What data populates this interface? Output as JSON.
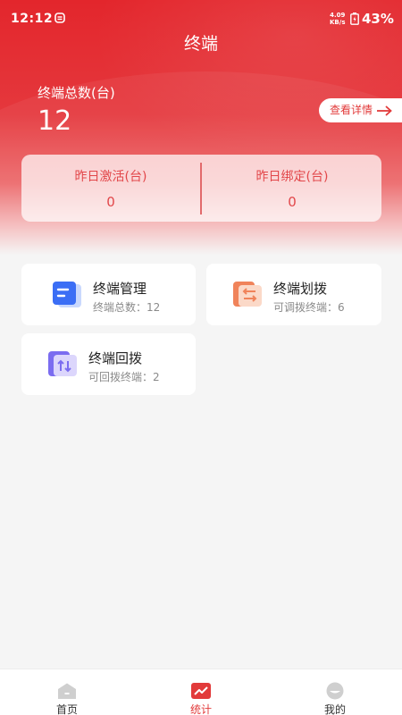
{
  "status_bar": {
    "time": "12:12",
    "net_speed_value": "4.09",
    "net_speed_unit": "KB/s",
    "battery": "43%"
  },
  "header": {
    "title": "终端"
  },
  "summary": {
    "total_label": "终端总数(台)",
    "total_value": "12",
    "details_button": "查看详情",
    "yesterday_activated_label": "昨日激活(台)",
    "yesterday_activated_value": "0",
    "yesterday_bound_label": "昨日绑定(台)",
    "yesterday_bound_value": "0"
  },
  "tiles": [
    {
      "title": "终端管理",
      "subtitle": "终端总数：12",
      "icon": "document-list-icon",
      "color": "#3b6ef5"
    },
    {
      "title": "终端划拨",
      "subtitle": "可调拨终端：6",
      "icon": "transfer-arrows-icon",
      "color": "#f0835a"
    },
    {
      "title": "终端回拨",
      "subtitle": "可回拨终端：2",
      "icon": "up-down-arrows-icon",
      "color": "#7b6cf0"
    }
  ],
  "bottom_nav": [
    {
      "label": "首页",
      "icon": "home-icon",
      "active": false
    },
    {
      "label": "统计",
      "icon": "chart-icon",
      "active": true
    },
    {
      "label": "我的",
      "icon": "profile-icon",
      "active": false
    }
  ],
  "colors": {
    "brand_red": "#e3262c",
    "accent_text": "#e2474a"
  }
}
